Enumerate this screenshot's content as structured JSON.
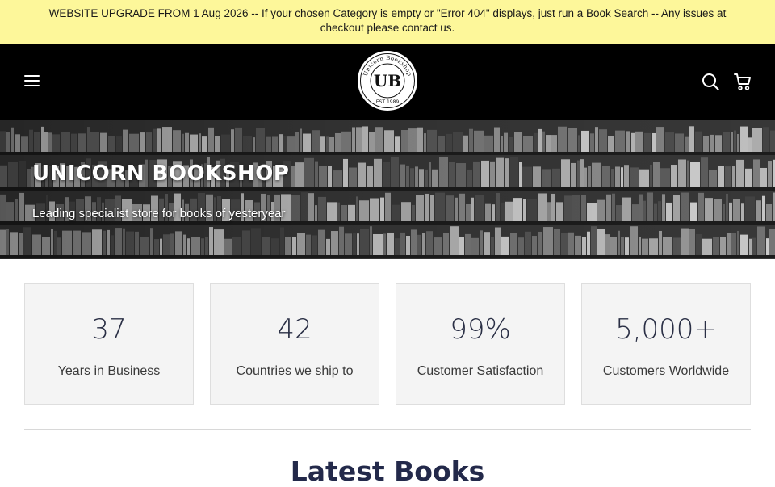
{
  "announcement": {
    "text": "WEBSITE UPGRADE FROM 1 Aug 2026 -- If your chosen Category is empty or \"Error 404\" displays, just run a Book Search -- Any issues at checkout please contact us."
  },
  "header": {
    "menu_icon": "hamburger-icon",
    "logo": {
      "initials": "UB",
      "ring_text": "Unicorn Bookshop",
      "est": "EST 1989"
    },
    "search_icon": "search-icon",
    "cart_icon": "cart-icon"
  },
  "hero": {
    "title": "UNICORN BOOKSHOP",
    "subtitle": "Leading specialist store for books of yesteryear"
  },
  "stats": [
    {
      "value": "37",
      "label": "Years in Business"
    },
    {
      "value": "42",
      "label": "Countries we ship to"
    },
    {
      "value": "99%",
      "label": "Customer Satisfaction"
    },
    {
      "value": "5,000+",
      "label": "Customers Worldwide"
    }
  ],
  "latest": {
    "title": "Latest Books"
  },
  "colors": {
    "announcement_bg": "#fdf79a",
    "header_bg": "#000000",
    "stat_card_bg": "#f4f4f4",
    "heading_navy": "#23294a"
  }
}
